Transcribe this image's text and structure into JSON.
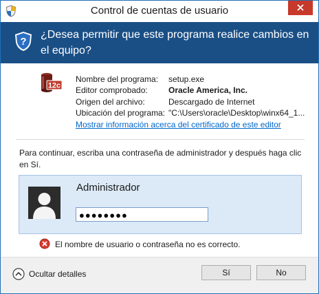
{
  "window": {
    "title": "Control de cuentas de usuario",
    "close_label": "close"
  },
  "banner": {
    "question": "¿Desea permitir que este programa realice cambios en el equipo?"
  },
  "program": {
    "icon": "oracle-12c-icon",
    "icon_text": "12c",
    "fields": [
      {
        "label": "Nombre del programa:",
        "value": "setup.exe"
      },
      {
        "label": "Editor comprobado:",
        "value": "Oracle America, Inc."
      },
      {
        "label": "Origen del archivo:",
        "value": "Descargado de Internet"
      },
      {
        "label": "Ubicación del programa:",
        "value": "\"C:\\Users\\oracle\\Desktop\\winx64_1..."
      }
    ],
    "cert_link": "Mostrar información acerca del certificado de este editor"
  },
  "credentials": {
    "instruction": "Para continuar, escriba una contraseña de administrador y después haga clic en Sí.",
    "username": "Administrador",
    "password_mask": "●●●●●●●●"
  },
  "error": {
    "message": "El nombre de usuario o contraseña no es correcto."
  },
  "footer": {
    "details_label": "Ocultar detalles",
    "yes_label": "Sí",
    "no_label": "No"
  },
  "colors": {
    "banner": "#1a4f86",
    "close": "#c7392b",
    "credential_panel": "#dce9f7",
    "link": "#0066cc"
  }
}
